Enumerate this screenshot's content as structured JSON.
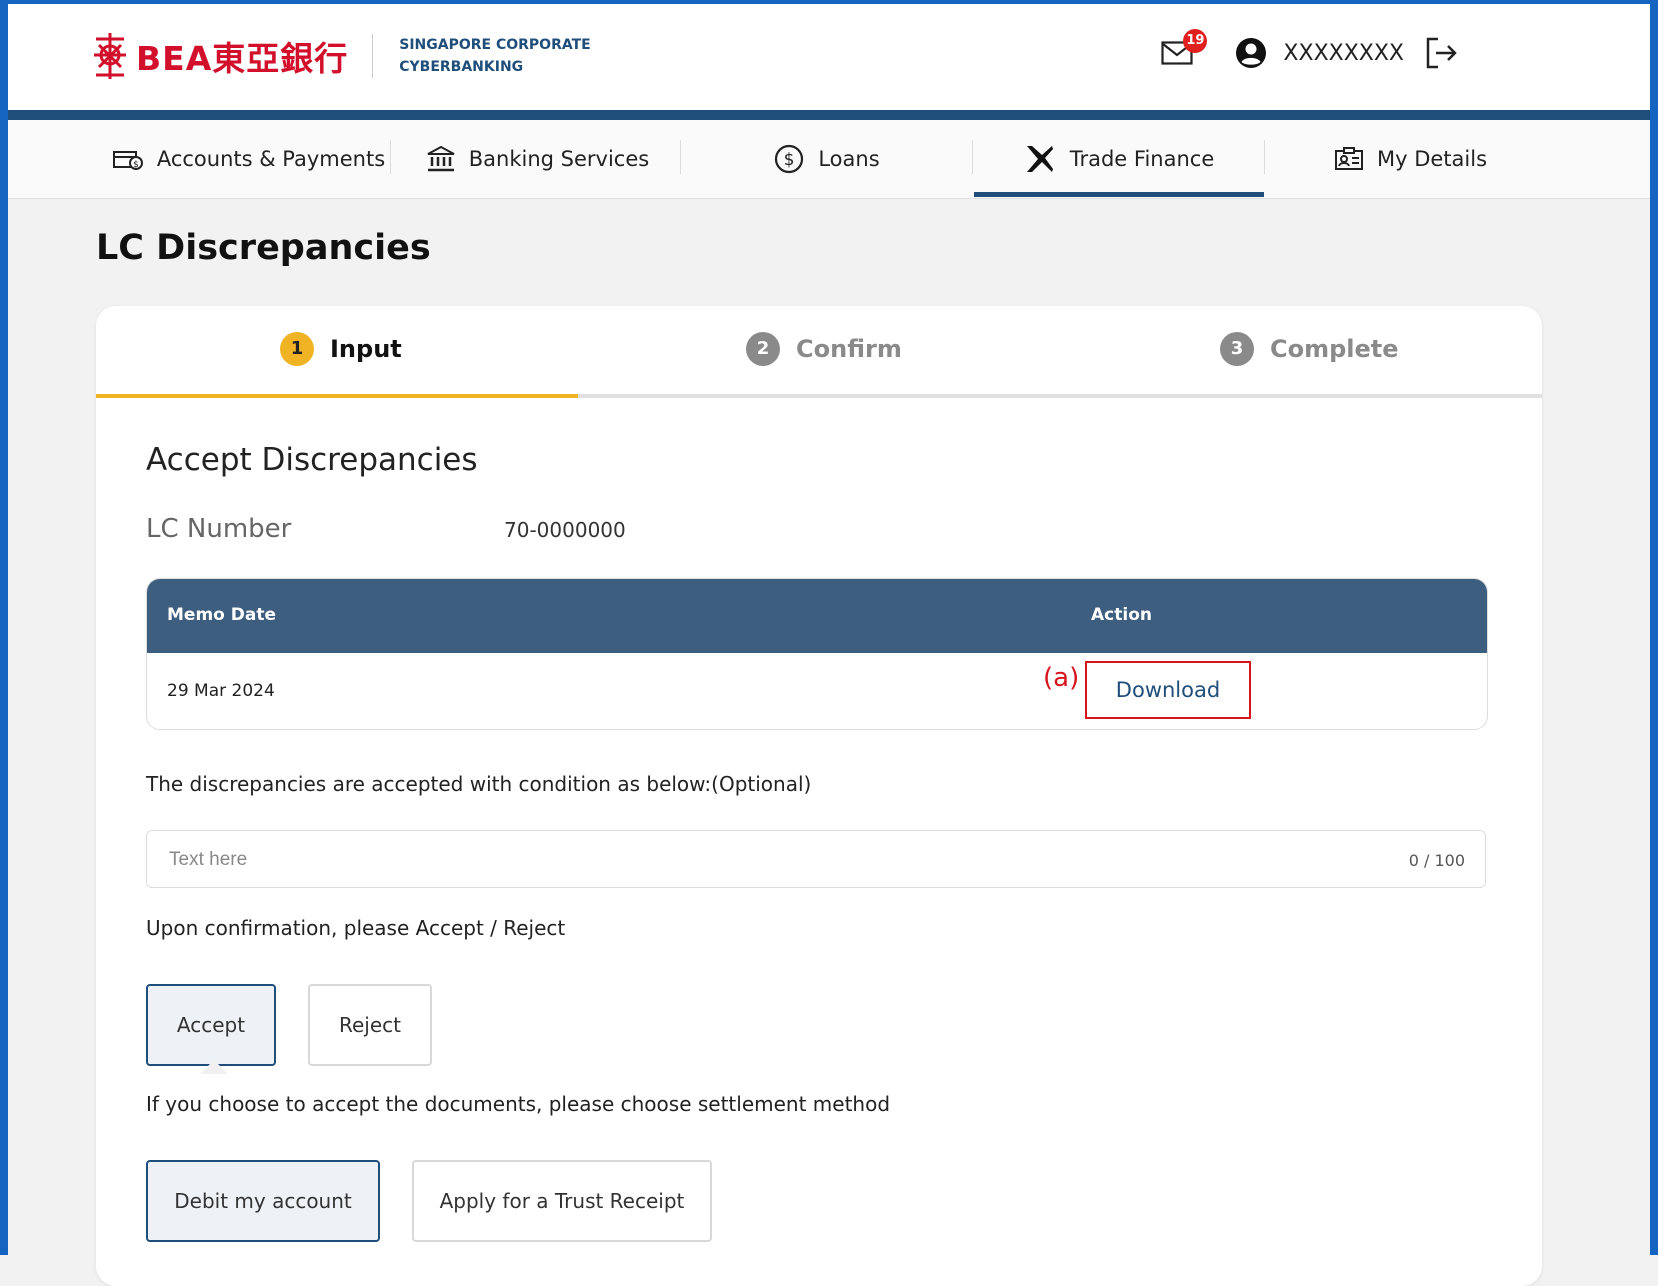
{
  "header": {
    "logo_text": "BEA東亞銀行",
    "corp_line1": "SINGAPORE CORPORATE",
    "corp_line2": "CYBERBANKING",
    "mail_count": "19",
    "username": "XXXXXXXX"
  },
  "nav": {
    "items": [
      {
        "label": "Accounts & Payments",
        "icon": "wallet-icon"
      },
      {
        "label": "Banking Services",
        "icon": "bank-icon"
      },
      {
        "label": "Loans",
        "icon": "dollar-circle-icon"
      },
      {
        "label": "Trade Finance",
        "icon": "airplane-icon",
        "active": true
      },
      {
        "label": "My Details",
        "icon": "id-card-icon"
      }
    ]
  },
  "page": {
    "title": "LC Discrepancies"
  },
  "steps": [
    {
      "num": "1",
      "label": "Input",
      "active": true
    },
    {
      "num": "2",
      "label": "Confirm",
      "active": false
    },
    {
      "num": "3",
      "label": "Complete",
      "active": false
    }
  ],
  "form": {
    "section_title": "Accept Discrepancies",
    "lc_label": "LC Number",
    "lc_value": "70-0000000",
    "table": {
      "headers": [
        "Memo Date",
        "Action"
      ],
      "rows": [
        {
          "date": "29 Mar 2024",
          "action": "Download",
          "annotation": "(a)"
        }
      ]
    },
    "condition_label": "The discrepancies are accepted with condition as below:(Optional)",
    "condition_placeholder": "Text here",
    "condition_value": "",
    "condition_counter": "0 / 100",
    "confirm_label": "Upon confirmation, please Accept / Reject",
    "accept_label": "Accept",
    "reject_label": "Reject",
    "accept_selected": true,
    "settle_label": "If you choose to accept the documents, please choose settlement method",
    "debit_label": "Debit my account",
    "trust_label": "Apply for a Trust Receipt",
    "debit_selected": true
  },
  "colors": {
    "brand_red": "#d2102b",
    "navy": "#1f4e7a",
    "table_header": "#3d5e7f",
    "step_active": "#f0b323",
    "step_inactive": "#8a8a8a",
    "annotation_red": "#d6141d",
    "frame_blue": "#1565c0"
  }
}
